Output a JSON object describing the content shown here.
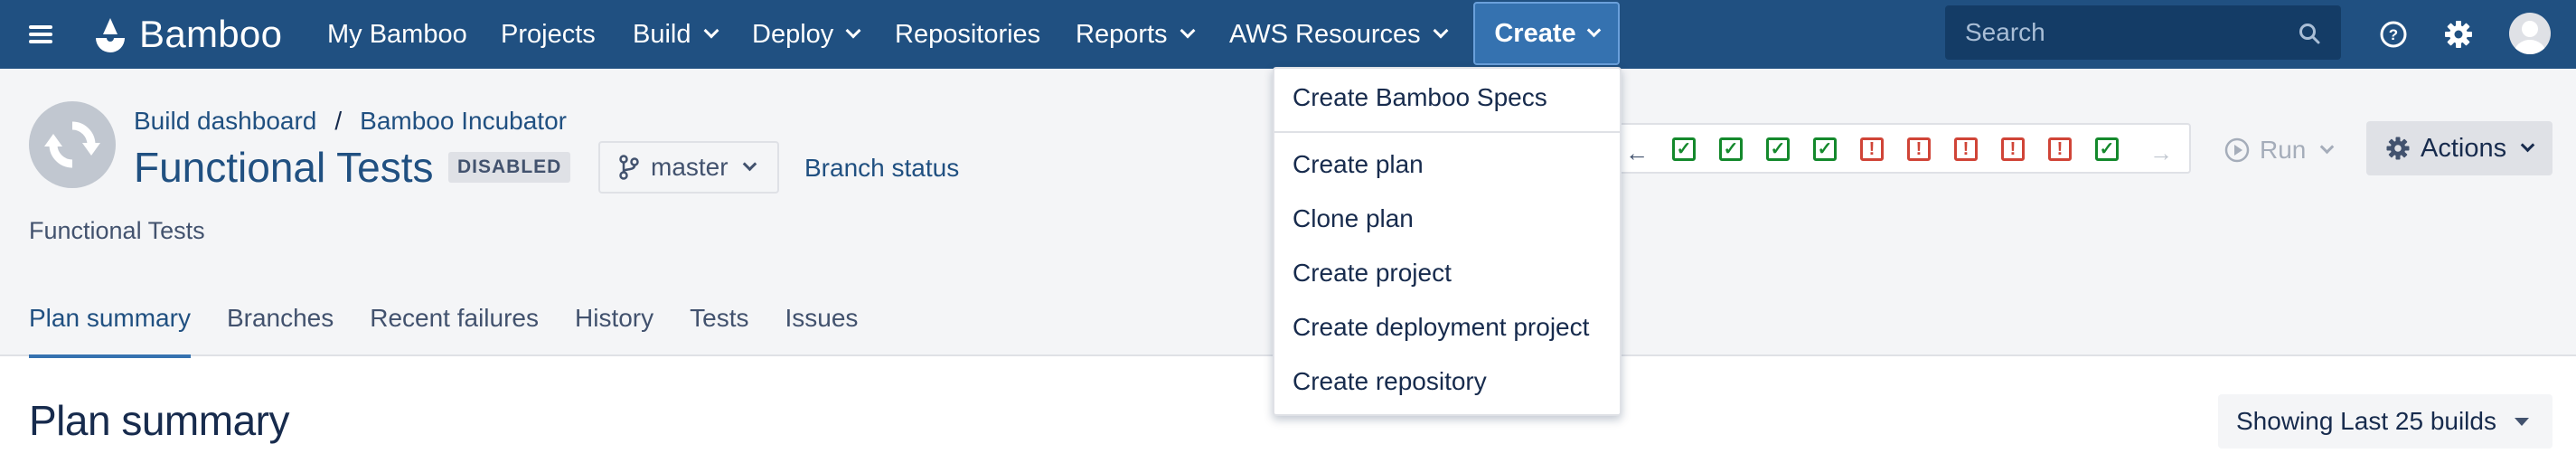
{
  "nav": {
    "logo_text": "Bamboo",
    "items": [
      {
        "label": "My Bamboo"
      },
      {
        "label": "Projects"
      },
      {
        "label": "Build"
      },
      {
        "label": "Deploy"
      },
      {
        "label": "Repositories"
      },
      {
        "label": "Reports"
      },
      {
        "label": "AWS Resources"
      }
    ],
    "create_label": "Create",
    "search_placeholder": "Search",
    "brand_color": "#205081",
    "create_color": "#3572b0"
  },
  "breadcrumb": {
    "items": [
      "Build dashboard",
      "Bamboo Incubator"
    ],
    "separator": "/"
  },
  "plan": {
    "title": "Functional Tests",
    "status_badge": "DISABLED",
    "branch": "master",
    "branch_status_link": "Branch status",
    "description": "Functional Tests"
  },
  "build_history": {
    "results": [
      "success",
      "success",
      "success",
      "success",
      "failed",
      "failed",
      "failed",
      "failed",
      "failed",
      "success"
    ],
    "success_color": "#14892c",
    "failed_color": "#d04437"
  },
  "toolbar": {
    "run_label": "Run",
    "actions_label": "Actions"
  },
  "tabs": [
    {
      "label": "Plan summary",
      "active": true
    },
    {
      "label": "Branches"
    },
    {
      "label": "Recent failures"
    },
    {
      "label": "History"
    },
    {
      "label": "Tests"
    },
    {
      "label": "Issues"
    }
  ],
  "main": {
    "section_title": "Plan summary",
    "showing_label": "Showing Last 25 builds"
  },
  "create_menu": {
    "items": [
      {
        "label": "Create Bamboo Specs"
      },
      {
        "label": "Create plan"
      },
      {
        "label": "Clone plan"
      },
      {
        "label": "Create project"
      },
      {
        "label": "Create deployment project"
      },
      {
        "label": "Create repository"
      }
    ]
  }
}
